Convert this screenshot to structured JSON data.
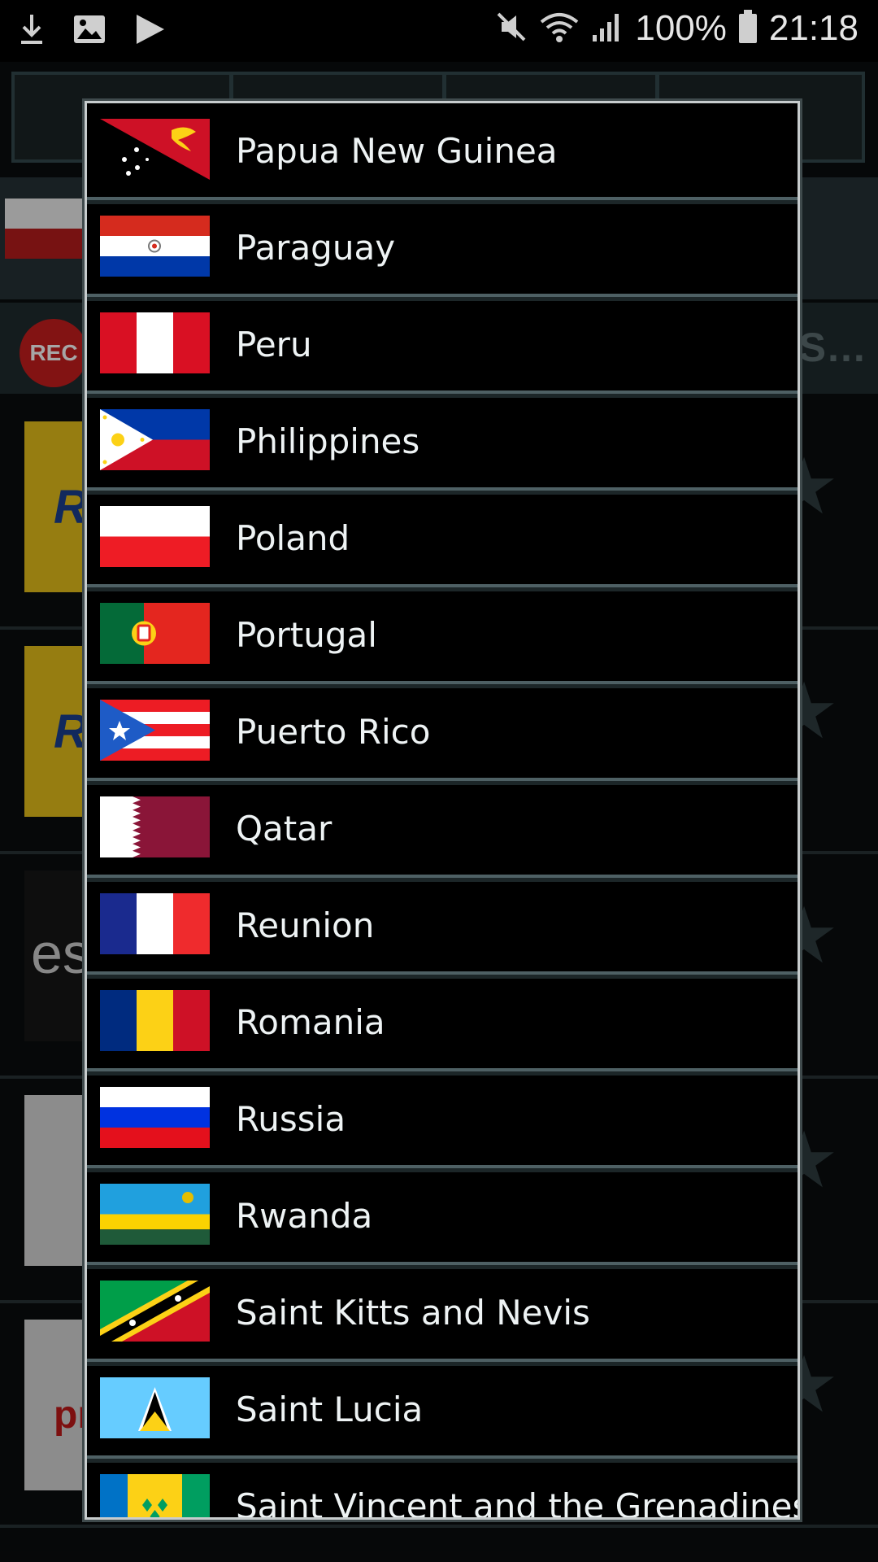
{
  "status_bar": {
    "battery_percent": "100%",
    "time": "21:18",
    "icons": [
      "download-icon",
      "image-icon",
      "play-icon",
      "mute-icon",
      "wifi-icon",
      "signal-icon",
      "battery-icon"
    ]
  },
  "background": {
    "rec_label": "REC",
    "rec_tail": "/ S…",
    "stations": [
      {
        "logo_text": "RA",
        "color": "#f2c400"
      },
      {
        "logo_text": "RA",
        "color": "#f2c400"
      },
      {
        "logo_text": "es",
        "color": "#141414"
      },
      {
        "logo_text": "",
        "color": "#e8e8e8"
      },
      {
        "logo_text": "pr",
        "color": "#e8e8e8"
      }
    ]
  },
  "country_list": {
    "items": [
      {
        "name": "Papua New Guinea",
        "flag": "papua-new-guinea"
      },
      {
        "name": "Paraguay",
        "flag": "paraguay"
      },
      {
        "name": "Peru",
        "flag": "peru"
      },
      {
        "name": "Philippines",
        "flag": "philippines"
      },
      {
        "name": "Poland",
        "flag": "poland"
      },
      {
        "name": "Portugal",
        "flag": "portugal"
      },
      {
        "name": "Puerto Rico",
        "flag": "puerto-rico"
      },
      {
        "name": "Qatar",
        "flag": "qatar"
      },
      {
        "name": "Reunion",
        "flag": "reunion"
      },
      {
        "name": "Romania",
        "flag": "romania"
      },
      {
        "name": "Russia",
        "flag": "russia"
      },
      {
        "name": "Rwanda",
        "flag": "rwanda"
      },
      {
        "name": "Saint Kitts and Nevis",
        "flag": "saint-kitts-and-nevis"
      },
      {
        "name": "Saint Lucia",
        "flag": "saint-lucia"
      },
      {
        "name": "Saint Vincent and the Grenadines",
        "flag": "saint-vincent"
      }
    ]
  }
}
